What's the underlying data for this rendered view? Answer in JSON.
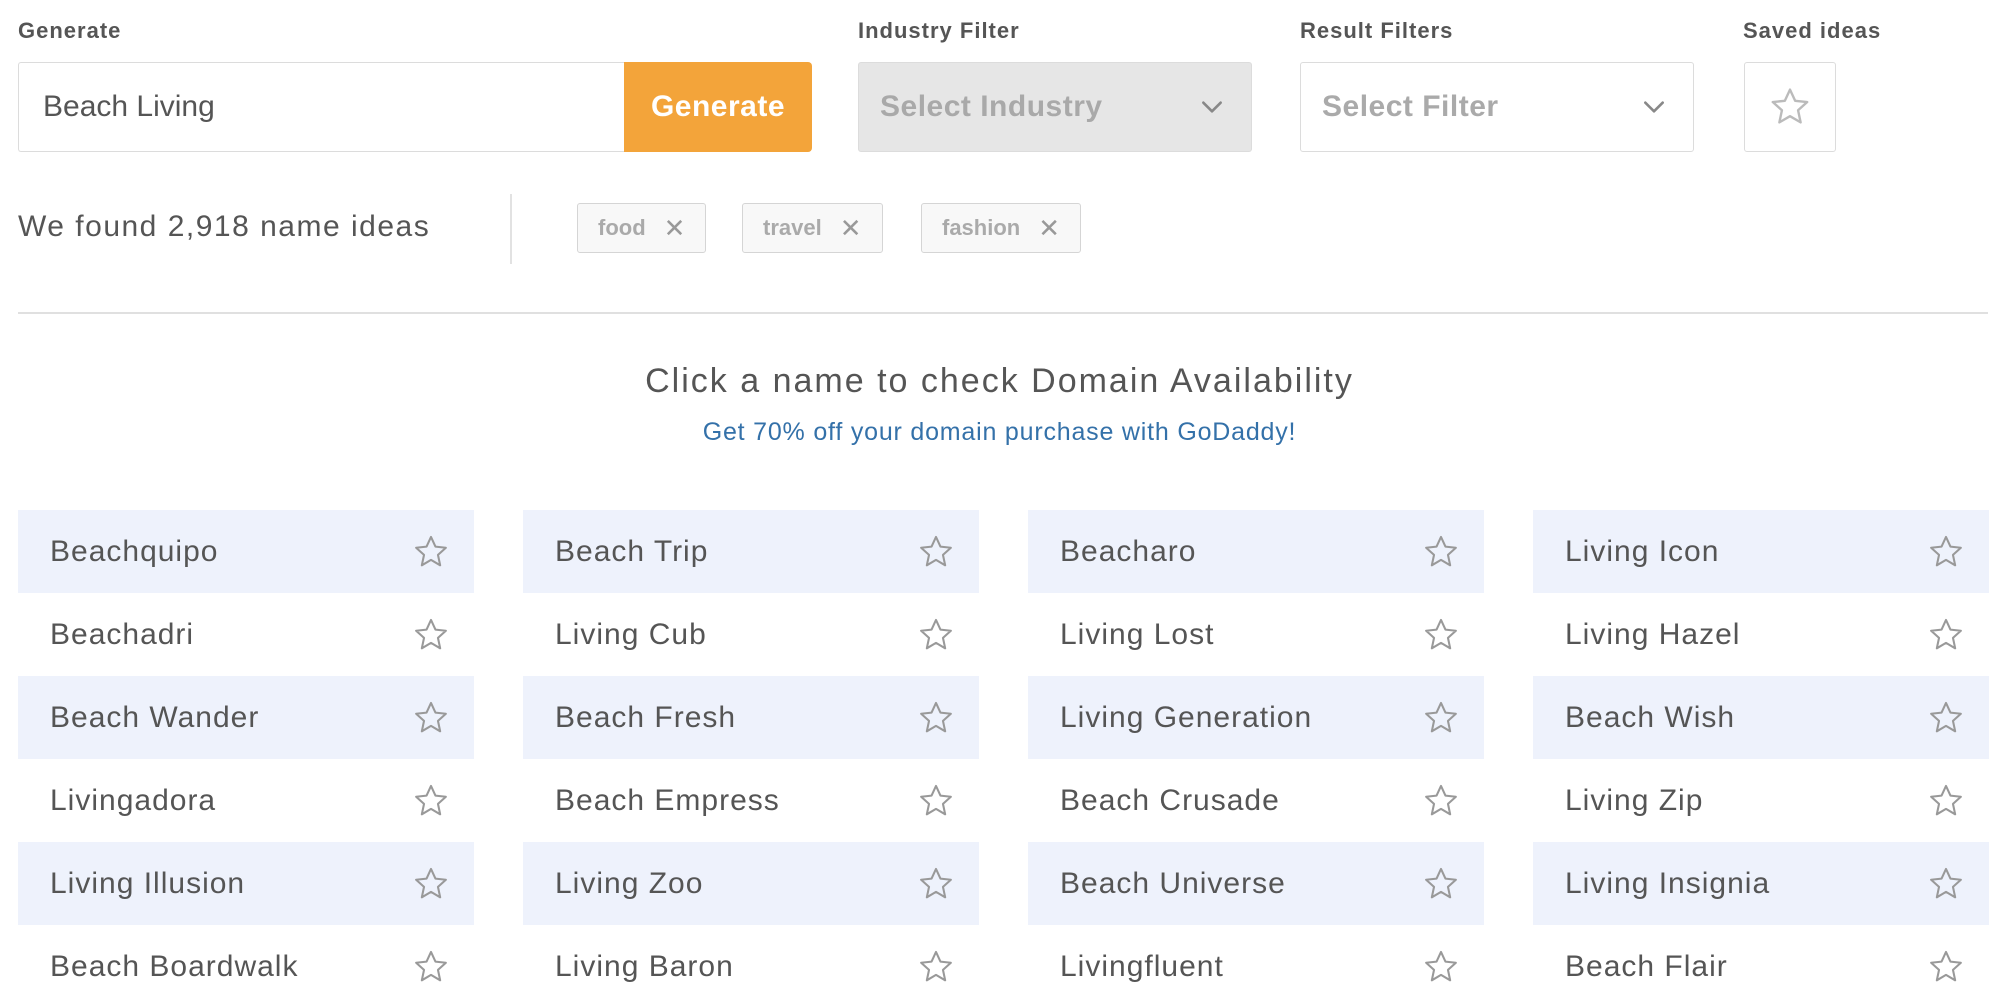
{
  "header": {
    "generate_label": "Generate",
    "generate_input_value": "Beach Living",
    "generate_button": "Generate",
    "industry_label": "Industry Filter",
    "industry_placeholder": "Select Industry",
    "result_label": "Result Filters",
    "result_placeholder": "Select Filter",
    "saved_label": "Saved ideas",
    "accent_color": "#f3a43a"
  },
  "summary": {
    "found_text": "We found 2,918 name ideas",
    "tags": [
      "food",
      "travel",
      "fashion"
    ]
  },
  "cta": {
    "title": "Click a name to check Domain Availability",
    "promo": "Get 70% off your domain purchase with GoDaddy!",
    "promo_color": "#3471a9"
  },
  "names": [
    [
      "Beachquipo",
      "Beach Trip",
      "Beacharo",
      "Living Icon"
    ],
    [
      "Beachadri",
      "Living Cub",
      "Living Lost",
      "Living Hazel"
    ],
    [
      "Beach Wander",
      "Beach Fresh",
      "Living Generation",
      "Beach Wish"
    ],
    [
      "Livingadora",
      "Beach Empress",
      "Beach Crusade",
      "Living Zip"
    ],
    [
      "Living Illusion",
      "Living Zoo",
      "Beach Universe",
      "Living Insignia"
    ],
    [
      "Beach Boardwalk",
      "Living Baron",
      "Livingfluent",
      "Beach Flair"
    ]
  ],
  "icons": {
    "favorite": "star-outline-icon",
    "dropdown": "chevron-down-icon",
    "remove_tag": "close-icon"
  }
}
